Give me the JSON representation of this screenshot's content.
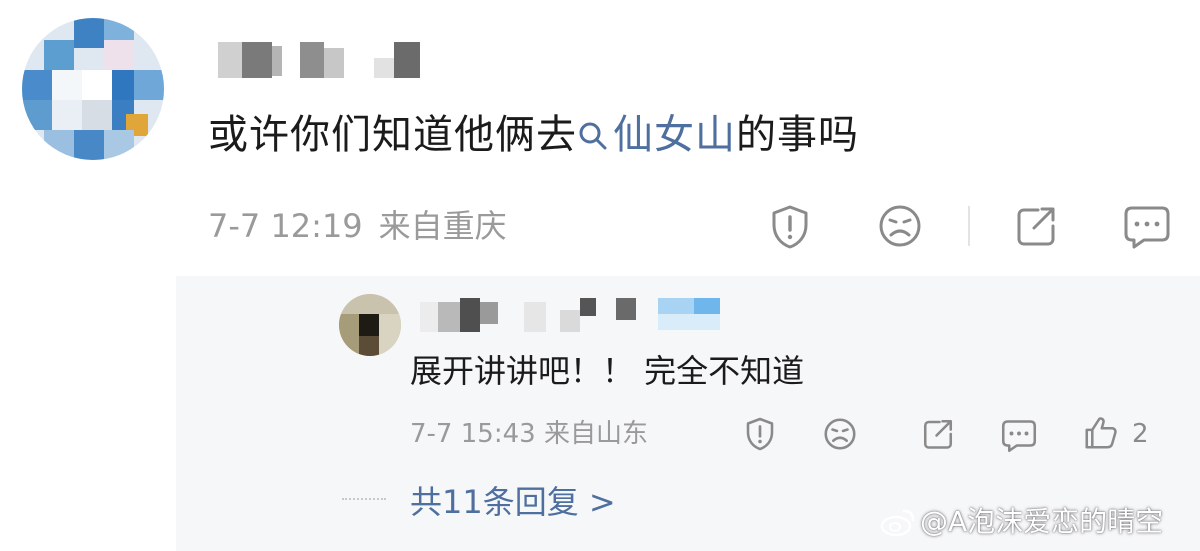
{
  "comment": {
    "text_before": "或许你们知道他俩去",
    "topic": "仙女山",
    "text_after": "的事吗",
    "time": "7-7 12:19",
    "location": "来自重庆",
    "icons": [
      "report-icon",
      "dislike-face-icon",
      "share-icon",
      "comment-icon"
    ]
  },
  "reply": {
    "text": "展开讲讲吧！！ 完全不知道",
    "time": "7-7 15:43",
    "location": "来自山东",
    "like_count": "2",
    "icons": [
      "report-icon",
      "dislike-face-icon",
      "share-icon",
      "comment-icon",
      "like-icon"
    ]
  },
  "more_replies_label": "共11条回复 >",
  "watermark": "@A泡沫爱恋的晴空",
  "colors": {
    "link": "#4f6f9f",
    "meta_text": "#9a9a9a",
    "reply_panel_bg": "#f6f7f9",
    "icon_stroke": "#8a8a8a"
  }
}
